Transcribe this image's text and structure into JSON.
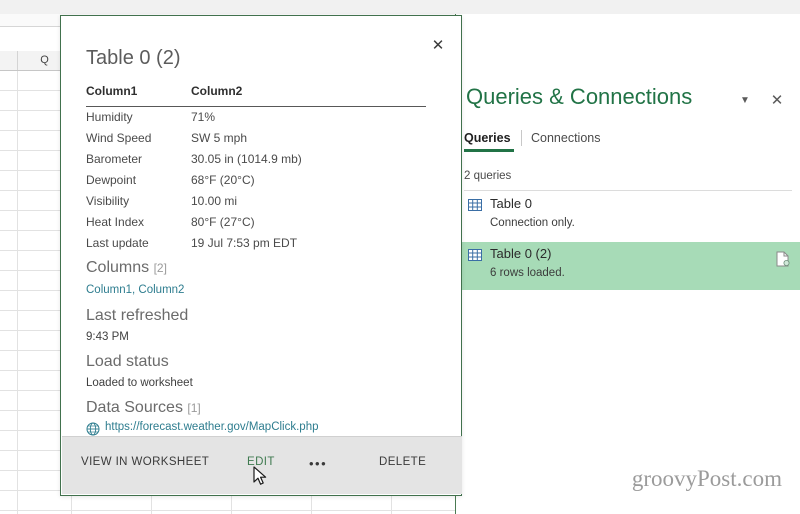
{
  "app": {
    "formula_bar_chevron": "chevron-down-icon",
    "grid_column_header": "Q",
    "watermark": "groovyPost.com"
  },
  "flyout": {
    "title": "Table 0 (2)",
    "close_icon": "close-icon",
    "preview": {
      "headers": [
        "Column1",
        "Column2"
      ],
      "rows": [
        [
          "Humidity",
          "71%"
        ],
        [
          "Wind Speed",
          "SW 5 mph"
        ],
        [
          "Barometer",
          "30.05 in (1014.9 mb)"
        ],
        [
          "Dewpoint",
          "68°F (20°C)"
        ],
        [
          "Visibility",
          "10.00 mi"
        ],
        [
          "Heat Index",
          "80°F (27°C)"
        ],
        [
          "Last update",
          "19 Jul 7:53 pm EDT"
        ]
      ]
    },
    "sections": {
      "columns": {
        "label": "Columns",
        "count": "[2]",
        "value": "Column1, Column2"
      },
      "last_refreshed": {
        "label": "Last refreshed",
        "value": "9:43 PM"
      },
      "load_status": {
        "label": "Load status",
        "value": "Loaded to worksheet"
      },
      "data_sources": {
        "label": "Data Sources",
        "count": "[1]",
        "icon": "globe-icon",
        "url": "https://forecast.weather.gov/MapClick.php"
      }
    },
    "actions": {
      "view_in_worksheet": "VIEW IN WORKSHEET",
      "edit": "EDIT",
      "more": "•••",
      "delete": "DELETE"
    }
  },
  "queries_pane": {
    "title": "Queries & Connections",
    "collapse_icon": "chevron-down-icon",
    "close_icon": "close-icon",
    "tabs": [
      {
        "label": "Queries",
        "active": true
      },
      {
        "label": "Connections",
        "active": false
      }
    ],
    "count_label": "2 queries",
    "items": [
      {
        "name": "Table 0",
        "status": "Connection only.",
        "selected": false,
        "icon": "table-icon"
      },
      {
        "name": "Table 0 (2)",
        "status": "6 rows loaded.",
        "selected": true,
        "icon": "table-icon",
        "trailing_icon": "document-refresh-icon"
      }
    ]
  },
  "colors": {
    "excel_green": "#217346",
    "selection_green": "#a7dbb7",
    "link_teal": "#2e7d8f",
    "flyout_border": "#41714d"
  }
}
